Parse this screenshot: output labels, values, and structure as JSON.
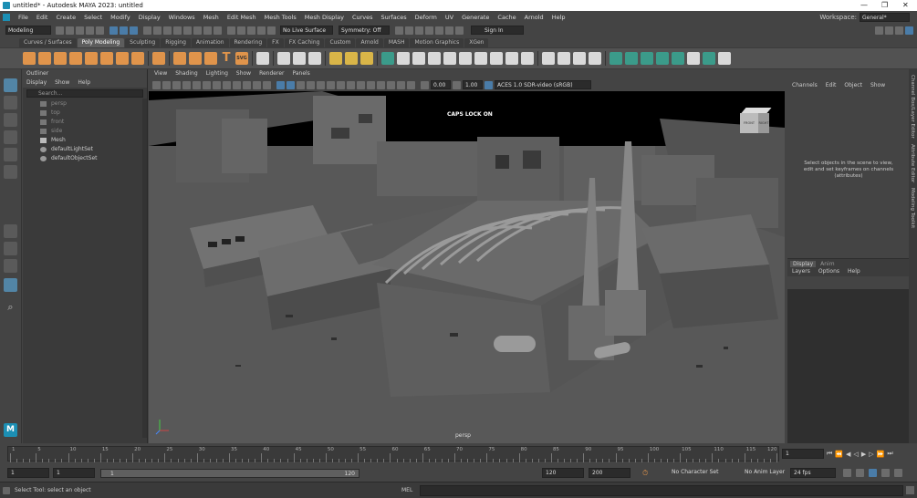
{
  "window": {
    "title": "untitled* - Autodesk MAYA 2023: untitled",
    "controls": [
      "—",
      "❐",
      "✕"
    ]
  },
  "menubar": {
    "items": [
      "File",
      "Edit",
      "Create",
      "Select",
      "Modify",
      "Display",
      "Windows",
      "Mesh",
      "Edit Mesh",
      "Mesh Tools",
      "Mesh Display",
      "Curves",
      "Surfaces",
      "Deform",
      "UV",
      "Generate",
      "Cache",
      "Arnold",
      "Help"
    ],
    "workspace_label": "Workspace:",
    "workspace_value": "General*"
  },
  "statusline": {
    "mode": "Modeling",
    "live_surface": "No Live Surface",
    "symmetry": "Symmetry: Off",
    "sign_in": "Sign In"
  },
  "shelf_tabs": [
    "Curves / Surfaces",
    "Poly Modeling",
    "Sculpting",
    "Rigging",
    "Animation",
    "Rendering",
    "FX",
    "FX Caching",
    "Custom",
    "Arnold",
    "MASH",
    "Motion Graphics",
    "XGen"
  ],
  "shelf_active": "Poly Modeling",
  "shelf_text_icons": {
    "text": "T",
    "svg": "SVG"
  },
  "outliner": {
    "title": "Outliner",
    "menu": [
      "Display",
      "Show",
      "Help"
    ],
    "search_placeholder": "Search...",
    "items": [
      {
        "label": "persp",
        "icon": "camera-icon",
        "dim": true
      },
      {
        "label": "top",
        "icon": "camera-icon",
        "dim": true
      },
      {
        "label": "front",
        "icon": "camera-icon",
        "dim": true
      },
      {
        "label": "side",
        "icon": "camera-icon",
        "dim": true
      },
      {
        "label": "Mesh",
        "icon": "mesh-icon",
        "dim": false
      },
      {
        "label": "defaultLightSet",
        "icon": "set-icon",
        "dim": false
      },
      {
        "label": "defaultObjectSet",
        "icon": "set-icon",
        "dim": false
      }
    ]
  },
  "viewport": {
    "menu": [
      "View",
      "Shading",
      "Lighting",
      "Show",
      "Renderer",
      "Panels"
    ],
    "exposure": "0.00",
    "gamma": "1.00",
    "color_space": "ACES 1.0 SDR-video (sRGB)",
    "caps_lock": "CAPS LOCK ON",
    "camera_label": "persp",
    "viewcube_front": "FRONT",
    "viewcube_right": "RIGHT"
  },
  "channelbox": {
    "menu": [
      "Channels",
      "Edit",
      "Object",
      "Show"
    ],
    "message": "Select objects in the scene to view, edit and set keyframes on channels (attributes)",
    "layer_tabs": [
      "Display",
      "Anim"
    ],
    "layer_menu": [
      "Layers",
      "Options",
      "Help"
    ]
  },
  "side_tabs": [
    "Channel Box/Layer Editor",
    "Attribute Editor",
    "Modeling Toolkit"
  ],
  "timeslider": {
    "ticks": [
      1,
      5,
      10,
      15,
      20,
      25,
      30,
      35,
      40,
      45,
      50,
      55,
      60,
      65,
      70,
      75,
      80,
      85,
      90,
      95,
      100,
      105,
      110,
      115,
      120
    ],
    "current_frame": "1"
  },
  "range": {
    "start": "1",
    "playback_start": "1",
    "range_slider_start": "1",
    "range_slider_end": "120",
    "playback_end": "120",
    "end": "200",
    "character_set": "No Character Set",
    "anim_layer": "No Anim Layer",
    "fps": "24 fps"
  },
  "helpline": {
    "message": "Select Tool: select an object",
    "script_lang": "MEL"
  }
}
